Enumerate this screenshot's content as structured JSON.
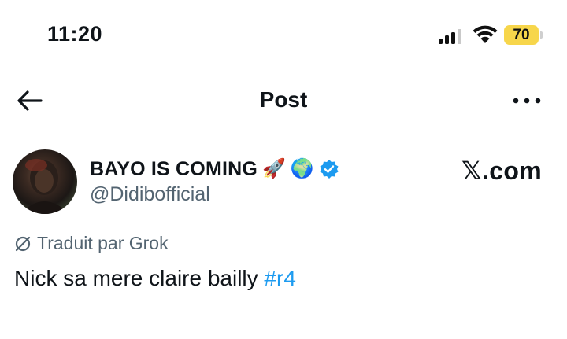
{
  "status_bar": {
    "time": "11:20",
    "battery_level": "70",
    "battery_color": "#f7d64b",
    "signal_bars_active": 3,
    "signal_bars_total": 4
  },
  "nav": {
    "title": "Post",
    "back_icon": "arrow-left-icon",
    "more_icon": "more-horizontal-icon"
  },
  "author": {
    "display_name": "BAYO IS COMING",
    "emojis": [
      "🚀",
      "🌍"
    ],
    "handle": "@Didibofficial",
    "verified": true,
    "verified_color": "#1d9bf0",
    "site_label": "𝕏.com"
  },
  "post": {
    "translation_note": "Traduit par Grok",
    "text": "Nick sa mere claire bailly ",
    "hashtag": "#r4"
  },
  "colors": {
    "accent": "#1d9bf0",
    "secondary_text": "#536471",
    "primary_text": "#0f1419"
  }
}
